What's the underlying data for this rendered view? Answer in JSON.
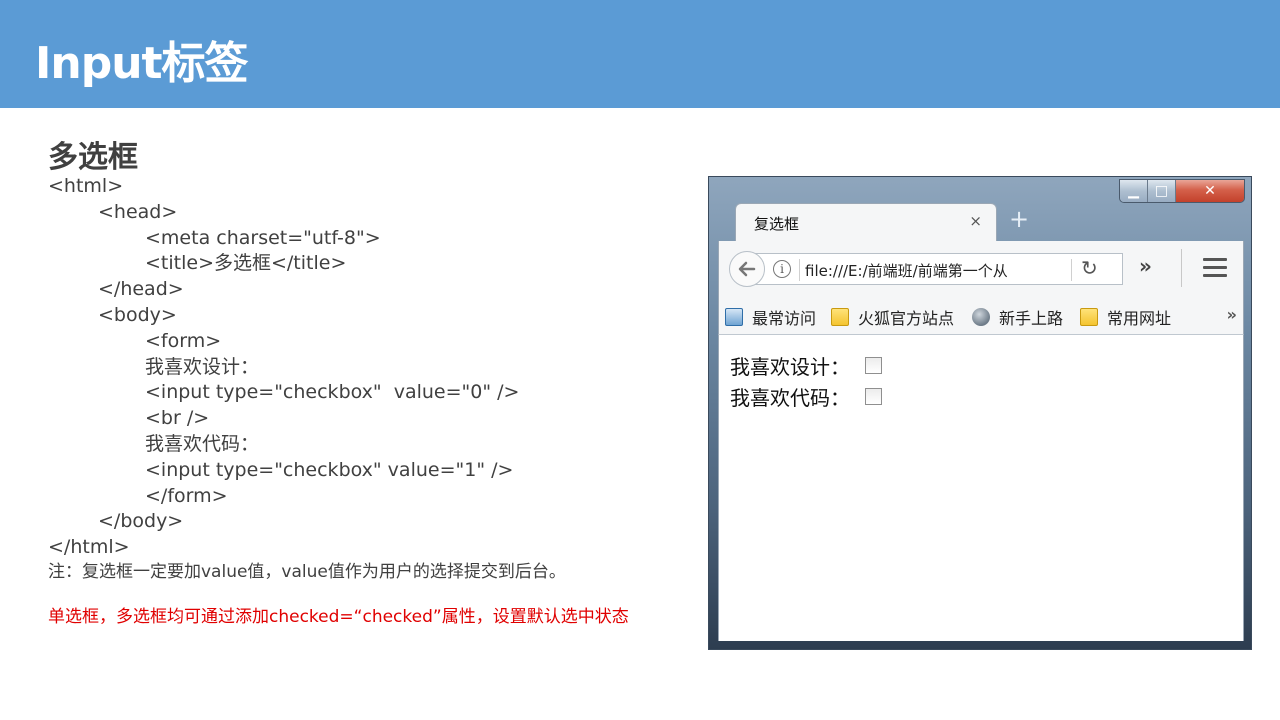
{
  "slide": {
    "title": "Input标签",
    "section_title": "多选框",
    "code_lines": [
      "<html>",
      "<head>",
      "<meta charset=\"utf-8\">",
      "<title>多选框</title>",
      "</head>",
      "<body>",
      "<form>",
      "我喜欢设计：",
      "<input type=\"checkbox\"  value=\"0\" />",
      "<br />",
      "我喜欢代码：",
      "<input type=\"checkbox\" value=\"1\" />",
      "</form>",
      "</body>",
      "</html>"
    ],
    "note": "注：复选框一定要加value值，value值作为用户的选择提交到后台。",
    "red_note": "单选框，多选框均可通过添加checked=“checked”属性，设置默认选中状态",
    "red_note_color": "#e00000",
    "header_color": "#5b9bd5"
  },
  "browser": {
    "window_controls": {
      "minimize": "▁",
      "maximize": "□",
      "close": "✕"
    },
    "tab": {
      "label": "复选框",
      "close": "×"
    },
    "new_tab": "+",
    "url": "file:///E:/前端班/前端第一个从",
    "overflow": "»",
    "bookmarks": [
      {
        "label": "最常访问",
        "icon": "search-folder-icon"
      },
      {
        "label": "火狐官方站点",
        "icon": "folder-icon"
      },
      {
        "label": "新手上路",
        "icon": "globe-icon"
      },
      {
        "label": "常用网址",
        "icon": "folder-icon"
      }
    ],
    "bookmarks_more": "»",
    "form": [
      {
        "label": "我喜欢设计：",
        "checked": false
      },
      {
        "label": "我喜欢代码：",
        "checked": false
      }
    ]
  }
}
